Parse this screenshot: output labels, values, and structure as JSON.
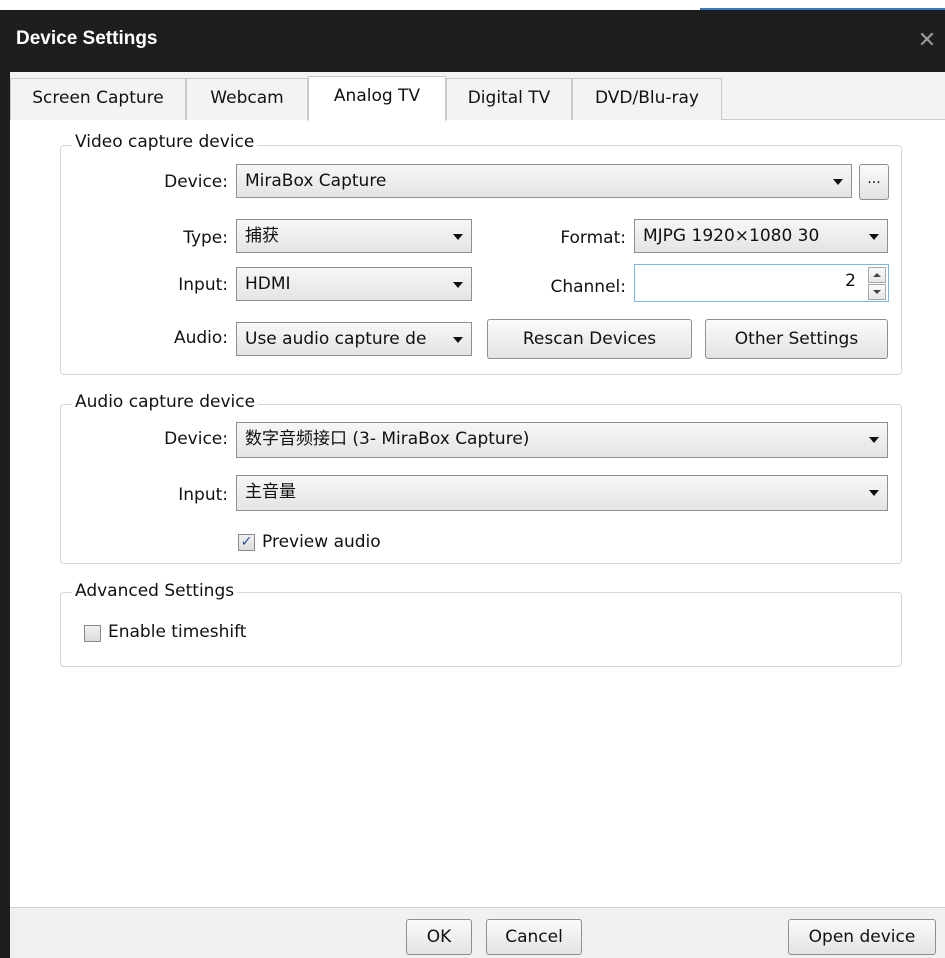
{
  "window": {
    "title": "Device Settings",
    "close_glyph": "✕"
  },
  "tabs": [
    {
      "label": "Screen Capture"
    },
    {
      "label": "Webcam"
    },
    {
      "label": "Analog TV"
    },
    {
      "label": "Digital TV"
    },
    {
      "label": "DVD/Blu-ray"
    }
  ],
  "active_tab": "Analog TV",
  "video_group": {
    "title": "Video capture device",
    "device_label": "Device:",
    "device_value": "MiraBox Capture",
    "browse_label": "...",
    "type_label": "Type:",
    "type_value": "捕获",
    "format_label": "Format:",
    "format_value": "MJPG 1920×1080 30",
    "input_label": "Input:",
    "input_value": "HDMI",
    "channel_label": "Channel:",
    "channel_value": "2",
    "audio_label": "Audio:",
    "audio_value": "Use audio capture de",
    "rescan_button": "Rescan Devices",
    "other_settings_button": "Other Settings"
  },
  "audio_group": {
    "title": "Audio capture device",
    "device_label": "Device:",
    "device_value": "数字音频接口 (3- MiraBox Capture)",
    "input_label": "Input:",
    "input_value": "主音量",
    "preview_label": "Preview audio",
    "preview_checked": true,
    "check_glyph": "✓"
  },
  "advanced_group": {
    "title": "Advanced Settings",
    "timeshift_label": "Enable timeshift",
    "timeshift_checked": false
  },
  "footer": {
    "ok_button": "OK",
    "cancel_button": "Cancel",
    "open_device_button": "Open device"
  }
}
